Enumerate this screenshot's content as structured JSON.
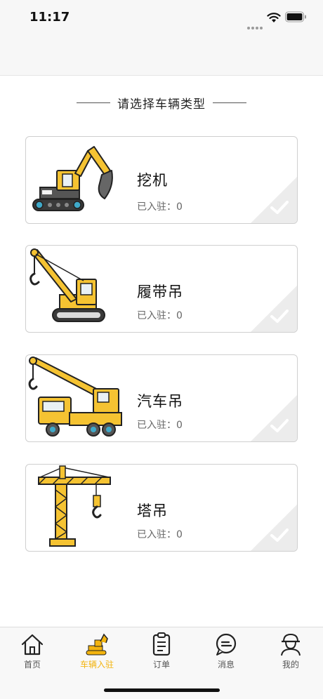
{
  "status_bar": {
    "time": "11:17"
  },
  "section": {
    "title": "请选择车辆类型"
  },
  "vehicles": [
    {
      "name": "挖机",
      "count": "已入驻：0",
      "icon": "excavator-icon"
    },
    {
      "name": "履带吊",
      "count": "已入驻：0",
      "icon": "crawler-crane-icon"
    },
    {
      "name": "汽车吊",
      "count": "已入驻：0",
      "icon": "truck-crane-icon"
    },
    {
      "name": "塔吊",
      "count": "已入驻：0",
      "icon": "tower-crane-icon"
    }
  ],
  "tabbar": {
    "items": [
      {
        "label": "首页",
        "icon": "home-icon"
      },
      {
        "label": "车辆入驻",
        "icon": "excavator-tab-icon",
        "active": true
      },
      {
        "label": "订单",
        "icon": "clipboard-icon"
      },
      {
        "label": "消息",
        "icon": "chat-icon"
      },
      {
        "label": "我的",
        "icon": "worker-icon"
      }
    ]
  },
  "colors": {
    "accent": "#f3b40f",
    "vehicle_yellow": "#f5c332",
    "dark": "#2b2b2b"
  }
}
